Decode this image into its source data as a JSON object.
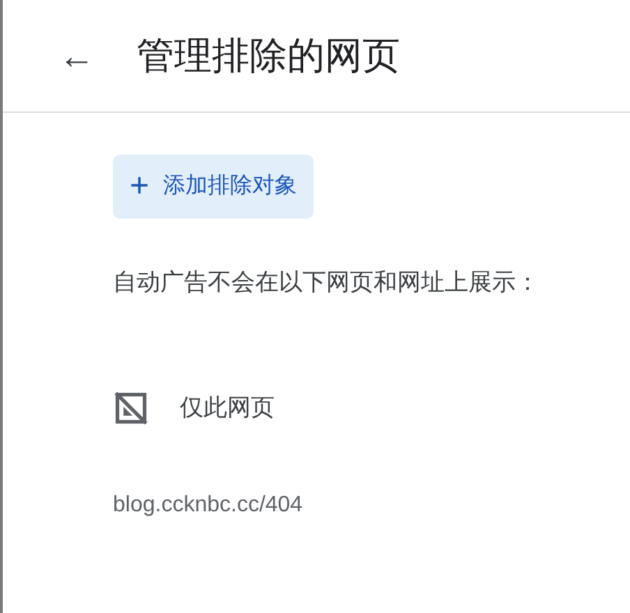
{
  "header": {
    "back": "←",
    "title": "管理排除的网页"
  },
  "add_button": {
    "icon": "+",
    "label": "添加排除对象"
  },
  "description": "自动广告不会在以下网页和网址上展示：",
  "exclusions": [
    {
      "kind": "page",
      "scope": "仅此网页",
      "url": "blog.ccknbc.cc/404"
    }
  ]
}
